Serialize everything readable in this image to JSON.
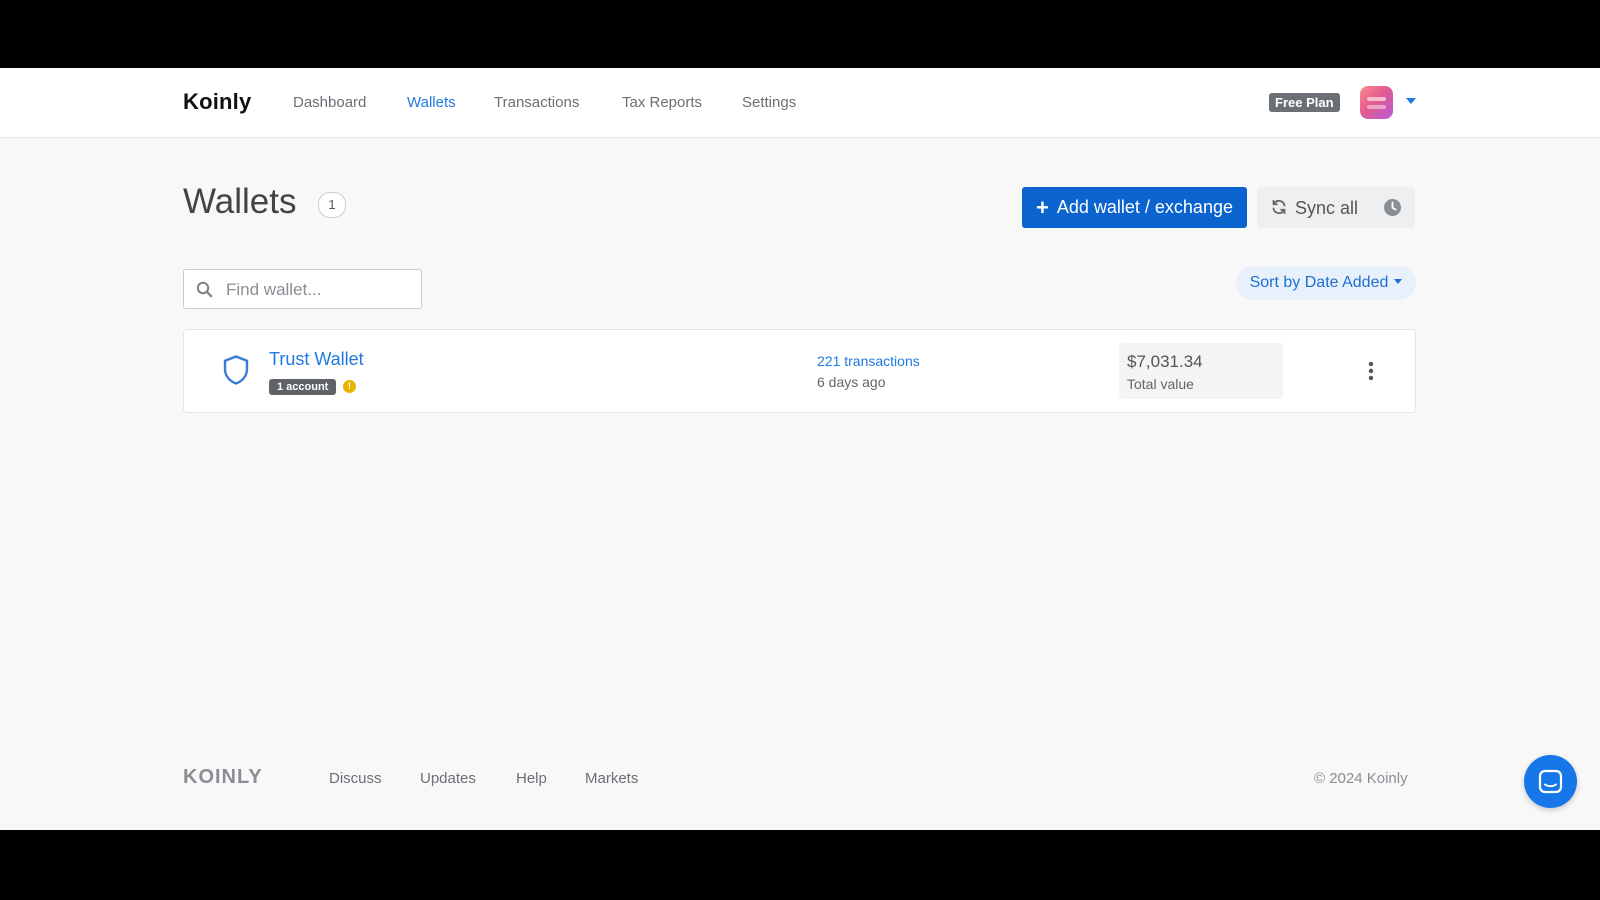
{
  "nav": {
    "brand": "Koinly",
    "items": [
      {
        "label": "Dashboard"
      },
      {
        "label": "Wallets"
      },
      {
        "label": "Transactions"
      },
      {
        "label": "Tax Reports"
      },
      {
        "label": "Settings"
      }
    ],
    "active": "Wallets",
    "plan_badge": "Free Plan"
  },
  "header": {
    "title": "Wallets",
    "count": "1",
    "add_button": "Add wallet / exchange",
    "sync_button": "Sync all"
  },
  "search": {
    "placeholder": "Find wallet..."
  },
  "sort": {
    "label": "Sort by Date Added"
  },
  "wallets": [
    {
      "name": "Trust Wallet",
      "accounts_badge": "1 account",
      "warning_glyph": "!",
      "transactions": "221 transactions",
      "synced": "6 days ago",
      "value": "$7,031.34",
      "value_label": "Total value"
    }
  ],
  "footer": {
    "logo": "KOINLY",
    "links": [
      {
        "label": "Discuss"
      },
      {
        "label": "Updates"
      },
      {
        "label": "Help"
      },
      {
        "label": "Markets"
      }
    ],
    "copyright": "© 2024 Koinly"
  },
  "colors": {
    "accent": "#1f7ae0",
    "primary_button": "#0b63ce",
    "warning": "#e8b400"
  }
}
